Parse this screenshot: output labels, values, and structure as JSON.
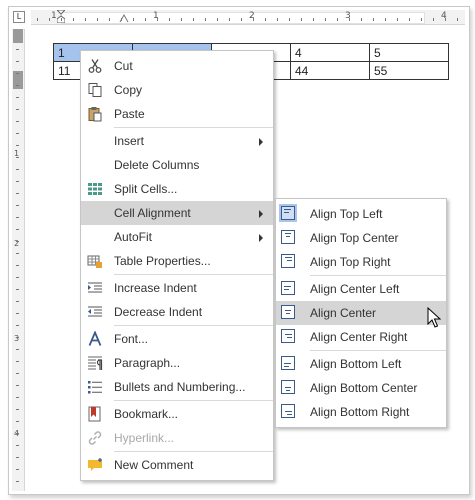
{
  "ruler": {
    "corner_glyph": "L",
    "top_numbers": [
      "1",
      "1",
      "2",
      "3",
      "4"
    ],
    "left_numbers": [
      "1",
      "2",
      "3",
      "4"
    ]
  },
  "table": {
    "rows": [
      [
        "1",
        "",
        "",
        "4",
        "5"
      ],
      [
        "11",
        "",
        "",
        "44",
        "55"
      ]
    ]
  },
  "context_menu": {
    "items": [
      {
        "label": "Cut",
        "icon": "scissors-icon"
      },
      {
        "label": "Copy",
        "icon": "copy-icon"
      },
      {
        "label": "Paste",
        "icon": "paste-icon"
      },
      {
        "label": "Insert",
        "icon": ""
      },
      {
        "label": "Delete Columns",
        "icon": ""
      },
      {
        "label": "Split Cells...",
        "icon": "split-cells-icon"
      },
      {
        "label": "Cell Alignment",
        "icon": ""
      },
      {
        "label": "AutoFit",
        "icon": ""
      },
      {
        "label": "Table Properties...",
        "icon": "table-properties-icon"
      },
      {
        "label": "Increase Indent",
        "icon": "increase-indent-icon"
      },
      {
        "label": "Decrease Indent",
        "icon": "decrease-indent-icon"
      },
      {
        "label": "Font...",
        "icon": "font-icon"
      },
      {
        "label": "Paragraph...",
        "icon": "paragraph-icon"
      },
      {
        "label": "Bullets and Numbering...",
        "icon": "bullets-icon"
      },
      {
        "label": "Bookmark...",
        "icon": "bookmark-icon"
      },
      {
        "label": "Hyperlink...",
        "icon": "hyperlink-icon"
      },
      {
        "label": "New Comment",
        "icon": "comment-icon"
      }
    ]
  },
  "submenu": {
    "items": [
      {
        "label": "Align Top Left"
      },
      {
        "label": "Align Top Center"
      },
      {
        "label": "Align Top Right"
      },
      {
        "label": "Align Center Left"
      },
      {
        "label": "Align Center"
      },
      {
        "label": "Align Center Right"
      },
      {
        "label": "Align Bottom Left"
      },
      {
        "label": "Align Bottom Center"
      },
      {
        "label": "Align Bottom Right"
      }
    ]
  },
  "colors": {
    "selection": "#a5c3ec",
    "highlight": "#d5d5d5",
    "icon_blue": "#3b5a8c",
    "bookmark_red": "#c0392b",
    "comment_yellow": "#f2b830"
  }
}
